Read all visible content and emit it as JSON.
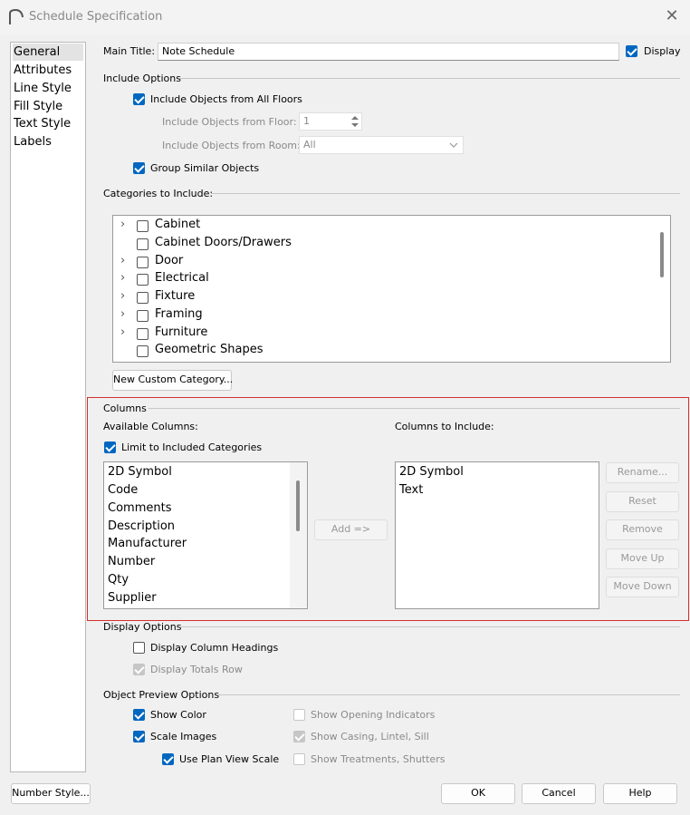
{
  "window": {
    "title": "Schedule Specification",
    "close": "✕"
  },
  "sidebar": {
    "items": [
      {
        "label": "General",
        "selected": true
      },
      {
        "label": "Attributes"
      },
      {
        "label": "Line Style"
      },
      {
        "label": "Fill Style"
      },
      {
        "label": "Text Style"
      },
      {
        "label": "Labels"
      }
    ]
  },
  "main_title": {
    "label": "Main Title:",
    "value": "Note Schedule",
    "display_label": "Display",
    "display_checked": true
  },
  "include_options": {
    "header": "Include Options",
    "all_floors_label": "Include Objects from All Floors",
    "from_floor_label": "Include Objects from Floor:",
    "from_floor_value": "1",
    "from_room_label": "Include Objects from Room:",
    "from_room_value": "All",
    "group_similar_label": "Group Similar Objects"
  },
  "categories": {
    "header": "Categories to Include:",
    "items": [
      "Cabinet",
      "Cabinet Doors/Drawers",
      "Door",
      "Electrical",
      "Fixture",
      "Framing",
      "Furniture",
      "Geometric Shapes"
    ],
    "new_button": "New Custom Category..."
  },
  "columns": {
    "header": "Columns",
    "available_label": "Available Columns:",
    "include_label": "Columns to Include:",
    "limit_label": "Limit to Included Categories",
    "available": [
      "2D Symbol",
      "Code",
      "Comments",
      "Description",
      "Manufacturer",
      "Number",
      "Qty",
      "Supplier"
    ],
    "included": [
      "2D Symbol",
      "Text"
    ],
    "add_button": "Add =>",
    "rename_button": "Rename...",
    "reset_button": "Reset",
    "remove_button": "Remove",
    "moveup_button": "Move Up",
    "movedown_button": "Move Down"
  },
  "display_options": {
    "header": "Display Options",
    "headings_label": "Display Column Headings",
    "totals_label": "Display Totals Row"
  },
  "preview_options": {
    "header": "Object Preview Options",
    "show_color": "Show Color",
    "scale_images": "Scale Images",
    "plan_view_scale": "Use Plan View Scale",
    "opening_indicators": "Show Opening Indicators",
    "casing": "Show Casing, Lintel, Sill",
    "treatments": "Show Treatments, Shutters"
  },
  "footer": {
    "number_style": "Number Style...",
    "ok": "OK",
    "cancel": "Cancel",
    "help": "Help"
  },
  "colors": {
    "accent": "#0067c0",
    "highlight_border": "#d32f2f"
  }
}
